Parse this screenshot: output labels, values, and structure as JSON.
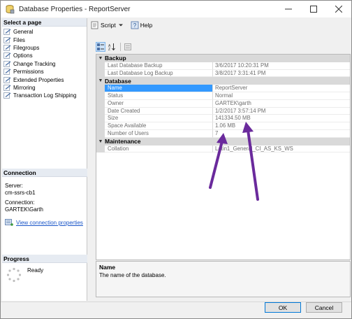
{
  "window": {
    "title": "Database Properties - ReportServer",
    "buttons": [
      "minimize",
      "maximize",
      "close"
    ]
  },
  "left_pane": {
    "select_page_header": "Select a page",
    "pages": [
      {
        "label": "General"
      },
      {
        "label": "Files"
      },
      {
        "label": "Filegroups"
      },
      {
        "label": "Options"
      },
      {
        "label": "Change Tracking"
      },
      {
        "label": "Permissions"
      },
      {
        "label": "Extended Properties"
      },
      {
        "label": "Mirroring"
      },
      {
        "label": "Transaction Log Shipping"
      }
    ],
    "connection_header": "Connection",
    "server_label": "Server:",
    "server_value": "cm-ssrs-cb1",
    "connection_label": "Connection:",
    "connection_value": "GARTEK\\Garth",
    "view_connection_link": "View connection properties",
    "progress_header": "Progress",
    "progress_status": "Ready"
  },
  "toolbar": {
    "script_label": "Script",
    "help_label": "Help"
  },
  "property_grid": {
    "categories": [
      {
        "name": "Backup",
        "rows": [
          {
            "name": "Last Database Backup",
            "value": "3/6/2017 10:20:31 PM"
          },
          {
            "name": "Last Database Log Backup",
            "value": "3/8/2017 3:31:41 PM"
          }
        ]
      },
      {
        "name": "Database",
        "rows": [
          {
            "name": "Name",
            "value": "ReportServer",
            "selected": true
          },
          {
            "name": "Status",
            "value": "Normal"
          },
          {
            "name": "Owner",
            "value": "GARTEK\\garth"
          },
          {
            "name": "Date Created",
            "value": "1/2/2017 3:57:14 PM"
          },
          {
            "name": "Size",
            "value": "141334.50 MB"
          },
          {
            "name": "Space Available",
            "value": "1.06 MB"
          },
          {
            "name": "Number of Users",
            "value": "7"
          }
        ]
      },
      {
        "name": "Maintenance",
        "rows": [
          {
            "name": "Collation",
            "value": "Latin1_General_CI_AS_KS_WS"
          }
        ]
      }
    ]
  },
  "description": {
    "title": "Name",
    "text": "The name of the database."
  },
  "buttons": {
    "ok": "OK",
    "cancel": "Cancel"
  },
  "colors": {
    "selection": "#3399ff",
    "category_band": "#d9d9d9",
    "arrow": "#6a2a9c"
  }
}
